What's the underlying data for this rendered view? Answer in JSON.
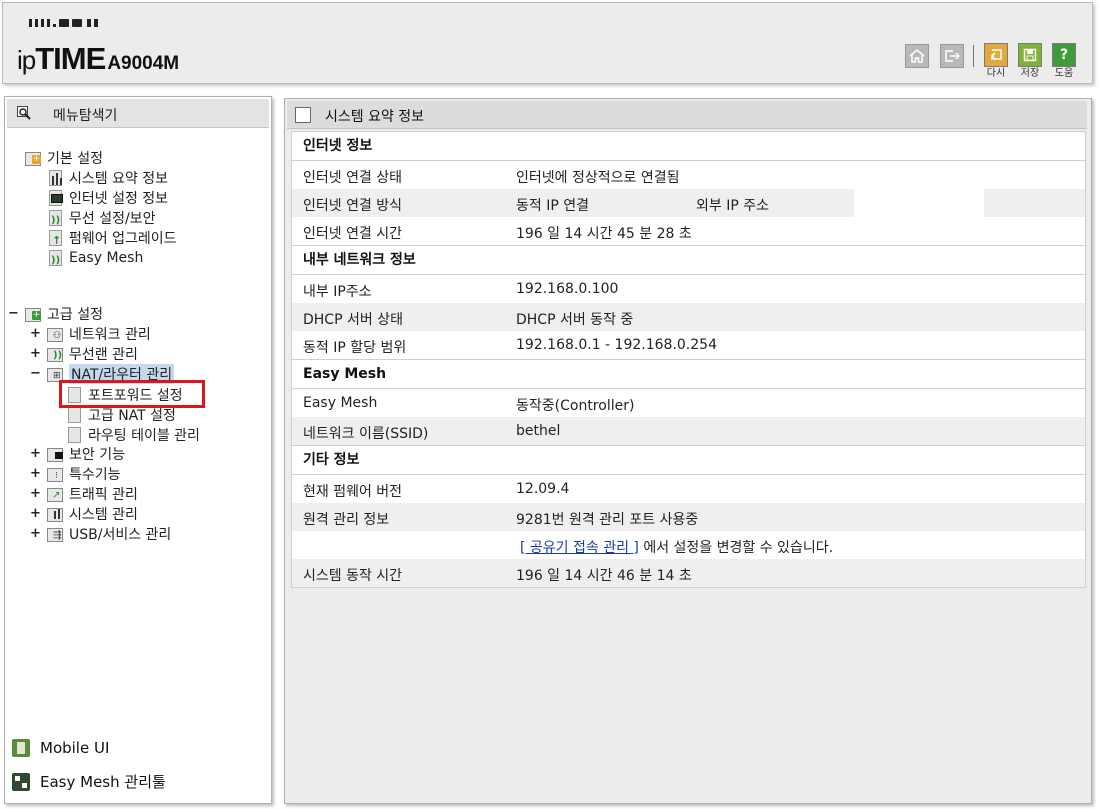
{
  "header": {
    "brand_ip": "ip",
    "brand_time": "TIME",
    "model": "A9004M",
    "buttons": [
      {
        "name": "home-icon"
      },
      {
        "name": "logout-icon"
      }
    ],
    "tools": [
      {
        "label": "다시",
        "icon": "reload-icon",
        "color": "#e3a93a"
      },
      {
        "label": "저장",
        "icon": "save-icon",
        "color": "#7fb235"
      },
      {
        "label": "도움",
        "icon": "help-icon",
        "color": "#3e9a3a"
      }
    ]
  },
  "sidebar": {
    "title": "메뉴탐색기",
    "basic": {
      "label": "기본 설정",
      "items": [
        "시스템 요약 정보",
        "인터넷 설정 정보",
        "무선 설정/보안",
        "펌웨어 업그레이드",
        "Easy Mesh"
      ]
    },
    "advanced": {
      "toggle": "−",
      "label": "고급 설정",
      "groups": [
        {
          "toggle": "+",
          "label": "네트워크 관리"
        },
        {
          "toggle": "+",
          "label": "무선랜 관리"
        },
        {
          "toggle": "−",
          "label": "NAT/라우터 관리"
        },
        {
          "toggle": "+",
          "label": "보안 기능"
        },
        {
          "toggle": "+",
          "label": "특수기능"
        },
        {
          "toggle": "+",
          "label": "트래픽 관리"
        },
        {
          "toggle": "+",
          "label": "시스템 관리"
        },
        {
          "toggle": "+",
          "label": "USB/서비스 관리"
        }
      ],
      "nat_children": [
        "포트포워드 설정",
        "고급 NAT 설정",
        "라우팅 테이블 관리"
      ]
    },
    "bottom_links": [
      "Mobile UI",
      "Easy Mesh 관리툴"
    ]
  },
  "main": {
    "title": "시스템 요약 정보",
    "internet": {
      "heading": "인터넷 정보",
      "status_label": "인터넷 연결 상태",
      "status_value": "인터넷에 정상적으로 연결됨",
      "method_label": "인터넷 연결 방식",
      "method_value": "동적 IP 연결",
      "external_ip_label": "외부 IP 주소",
      "time_label": "인터넷 연결 시간",
      "time_value": "196 일 14 시간 45 분 28 초"
    },
    "lan": {
      "heading": "내부 네트워크 정보",
      "ip_label": "내부 IP주소",
      "ip_value": "192.168.0.100",
      "dhcp_label": "DHCP 서버 상태",
      "dhcp_value": "DHCP 서버 동작 중",
      "range_label": "동적 IP 할당 범위",
      "range_value": "192.168.0.1 -  192.168.0.254"
    },
    "mesh": {
      "heading": "Easy Mesh",
      "mesh_label": "Easy Mesh",
      "mesh_value": "동작중(Controller)",
      "ssid_label": "네트워크 이름(SSID)",
      "ssid_value": "bethel"
    },
    "etc": {
      "heading": "기타 정보",
      "fw_label": "현재 펌웨어 버전",
      "fw_value": "12.09.4",
      "remote_label": "원격 관리 정보",
      "remote_value": "9281번 원격 관리 포트 사용중",
      "link_text": "[ 공유기 접속 관리 ]",
      "link_suffix": " 에서 설정을 변경할 수 있습니다.",
      "uptime_label": "시스템 동작 시간",
      "uptime_value": "196 일 14 시간 46 분 14 초"
    }
  }
}
